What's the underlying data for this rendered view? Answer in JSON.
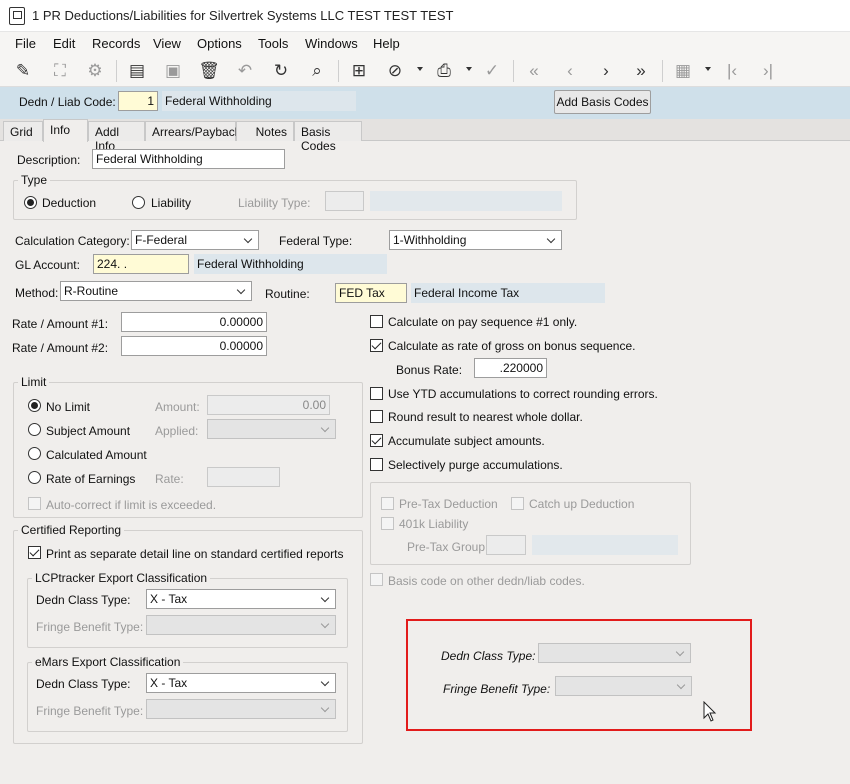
{
  "window": {
    "title": "1 PR Deductions/Liabilities for Silvertrek Systems LLC TEST TEST TEST"
  },
  "menu": [
    "File",
    "Edit",
    "Records",
    "View",
    "Options",
    "Tools",
    "Windows",
    "Help"
  ],
  "toolbar": {
    "icons": [
      "edit-icon",
      "binoculars-icon",
      "gear-icon",
      "document-icon",
      "save-icon",
      "trash-icon",
      "undo-icon",
      "refresh-icon",
      "search-icon",
      "grid-icon",
      "paperclip-icon",
      "print-icon",
      "spellcheck-icon",
      "first-icon",
      "previous-icon",
      "next-icon",
      "last-icon",
      "table-settings-icon",
      "step-first-icon",
      "step-last-icon"
    ]
  },
  "header": {
    "code_label": "Dedn / Liab Code:",
    "code_value": "1",
    "code_description": "Federal Withholding",
    "add_basis_button": "Add Basis Codes"
  },
  "tabs": [
    "Grid",
    "Info",
    "Addl Info",
    "Arrears/Payback",
    "Notes",
    "Basis Codes"
  ],
  "form": {
    "description_label": "Description:",
    "description_value": "Federal Withholding",
    "type_group": "Type",
    "deduction_label": "Deduction",
    "liability_label": "Liability",
    "liability_type_label": "Liability Type:",
    "calc_category_label": "Calculation Category:",
    "calc_category_value": "F-Federal",
    "federal_type_label": "Federal Type:",
    "federal_type_value": "1-Withholding",
    "gl_account_label": "GL Account:",
    "gl_account_value": "224.  .",
    "gl_account_description": "Federal Withholding",
    "method_label": "Method:",
    "method_value": "R-Routine",
    "routine_label": "Routine:",
    "routine_value": "FED Tax",
    "routine_description": "Federal Income Tax",
    "rate1_label": "Rate / Amount #1:",
    "rate1_value": "0.00000",
    "rate2_label": "Rate / Amount #2:",
    "rate2_value": "0.00000"
  },
  "limit": {
    "group": "Limit",
    "no_limit": "No Limit",
    "subject_amount": "Subject Amount",
    "calculated_amount": "Calculated Amount",
    "rate_of_earnings": "Rate of Earnings",
    "amount_label": "Amount:",
    "amount_value": "0.00",
    "applied_label": "Applied:",
    "rate_label": "Rate:",
    "autocorrect": "Auto-correct if limit is exceeded."
  },
  "certified": {
    "group": "Certified Reporting",
    "print_separate": "Print as separate detail line on standard certified reports",
    "lcp_group": "LCPtracker Export Classification",
    "lcp_dedn_class_label": "Dedn Class Type:",
    "lcp_dedn_class_value": "X - Tax",
    "lcp_fringe_label": "Fringe Benefit Type:",
    "emars_group": "eMars Export Classification",
    "emars_dedn_class_label": "Dedn Class Type:",
    "emars_dedn_class_value": "X - Tax",
    "emars_fringe_label": "Fringe Benefit Type:"
  },
  "options": {
    "pay_seq1": "Calculate on pay sequence #1 only.",
    "rate_of_gross": "Calculate as rate of gross on bonus sequence.",
    "bonus_rate_label": "Bonus Rate:",
    "bonus_rate_value": ".220000",
    "ytd_accum": "Use YTD accumulations to correct rounding errors.",
    "round_whole": "Round result to nearest whole dollar.",
    "accumulate_subject": "Accumulate subject amounts.",
    "selective_purge": "Selectively purge accumulations.",
    "pretax_deduction": "Pre-Tax Deduction",
    "catchup_deduction": "Catch up Deduction",
    "liability_401k": "401k Liability",
    "pretax_group_label": "Pre-Tax Group:",
    "basis_code_other": "Basis code on other dedn/liab codes."
  },
  "highlight": {
    "dedn_class_label": "Dedn Class Type:",
    "fringe_label": "Fringe Benefit Type:",
    "box_color": "#e21b1b"
  }
}
